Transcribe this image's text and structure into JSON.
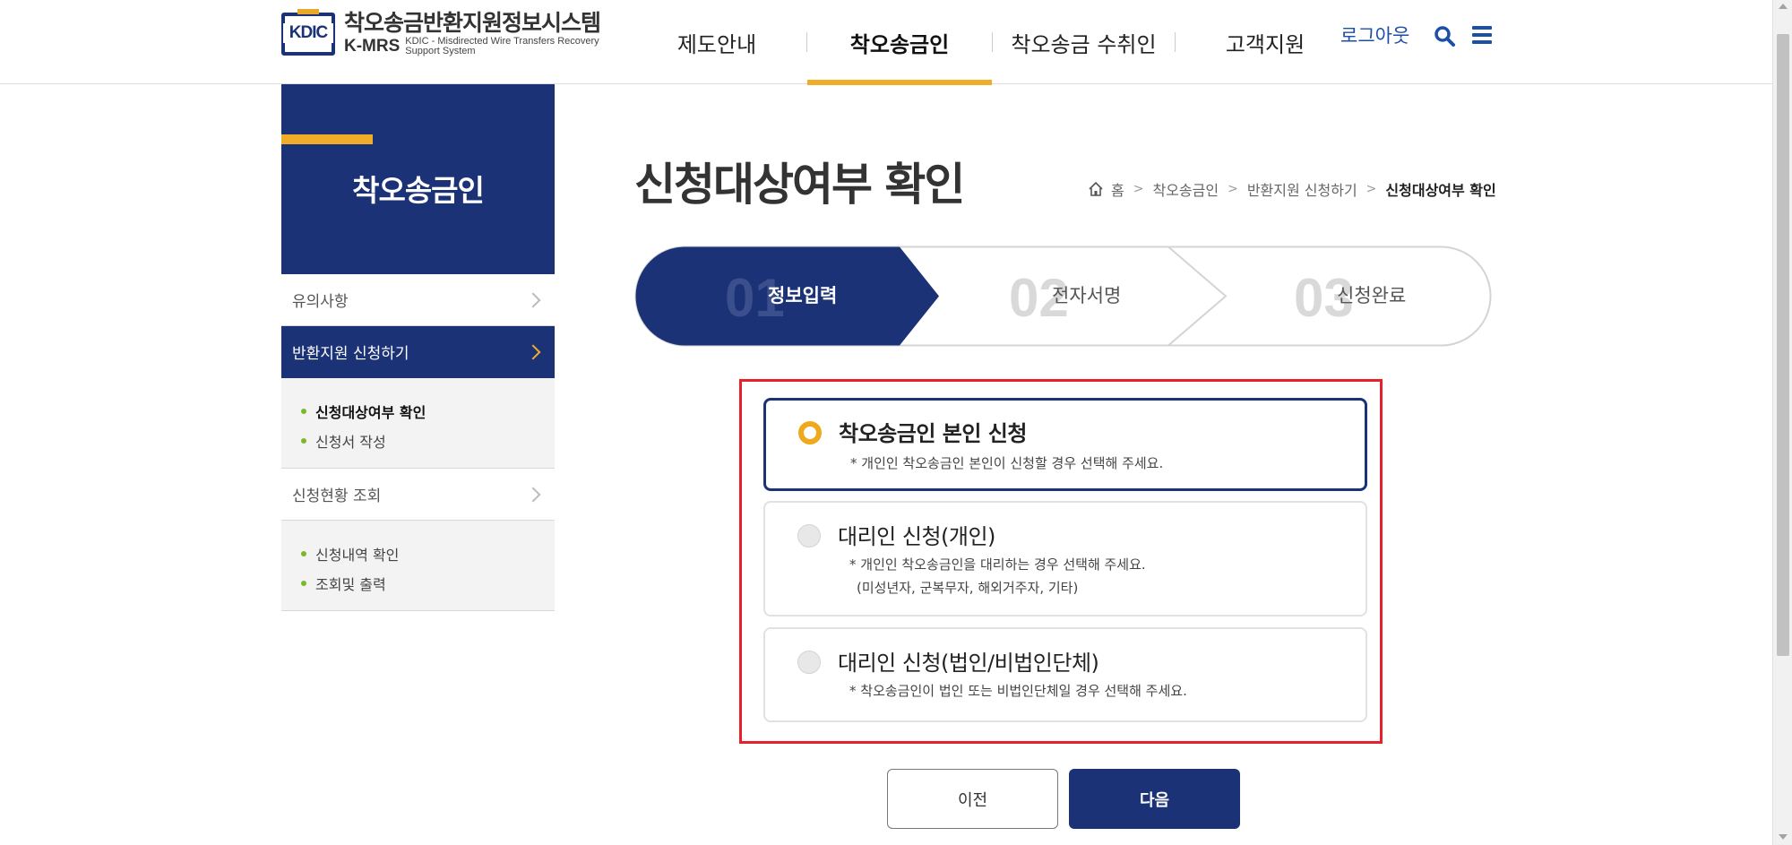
{
  "header": {
    "logo_mark": "KDIC",
    "logo_title": "착오송금반환지원정보시스템",
    "logo_abbr": "K-MRS",
    "logo_eng": "KDIC - Misdirected Wire Transfers Recovery Support System",
    "nav": [
      "제도안내",
      "착오송금인",
      "착오송금 수취인",
      "고객지원"
    ],
    "active_nav_index": 1,
    "logout_label": "로그아웃",
    "icons": [
      "search-icon",
      "menu-icon"
    ],
    "accent_color": "#f0ad2a",
    "brand_color": "#1b3277"
  },
  "sidebar": {
    "title": "착오송금인",
    "menus": [
      {
        "label": "유의사항",
        "active": false,
        "subitems": []
      },
      {
        "label": "반환지원 신청하기",
        "active": true,
        "subitems": [
          "신청대상여부 확인",
          "신청서 작성"
        ]
      },
      {
        "label": "신청현황 조회",
        "active": false,
        "subitems": [
          "신청내역 확인",
          "조회및 출력"
        ]
      }
    ],
    "current_subitem": "신청대상여부 확인"
  },
  "main": {
    "page_title": "신청대상여부 확인",
    "breadcrumb": [
      "홈",
      "착오송금인",
      "반환지원 신청하기",
      "신청대상여부 확인"
    ],
    "steps": [
      {
        "num": "01",
        "label": "정보입력",
        "active": true
      },
      {
        "num": "02",
        "label": "전자서명",
        "active": false
      },
      {
        "num": "03",
        "label": "신청완료",
        "active": false
      }
    ],
    "options": [
      {
        "title": "착오송금인 본인 신청",
        "desc": [
          "* 개인인 착오송금인 본인이 신청할 경우 선택해 주세요."
        ],
        "selected": true
      },
      {
        "title": "대리인 신청(개인)",
        "desc": [
          "* 개인인 착오송금인을 대리하는 경우 선택해 주세요.",
          "(미성년자, 군복무자, 해외거주자, 기타)"
        ],
        "selected": false
      },
      {
        "title": "대리인 신청(법인/비법인단체)",
        "desc": [
          "* 착오송금인이 법인 또는 비법인단체일 경우 선택해 주세요."
        ],
        "selected": false
      }
    ],
    "buttons": {
      "prev": "이전",
      "next": "다음"
    }
  }
}
